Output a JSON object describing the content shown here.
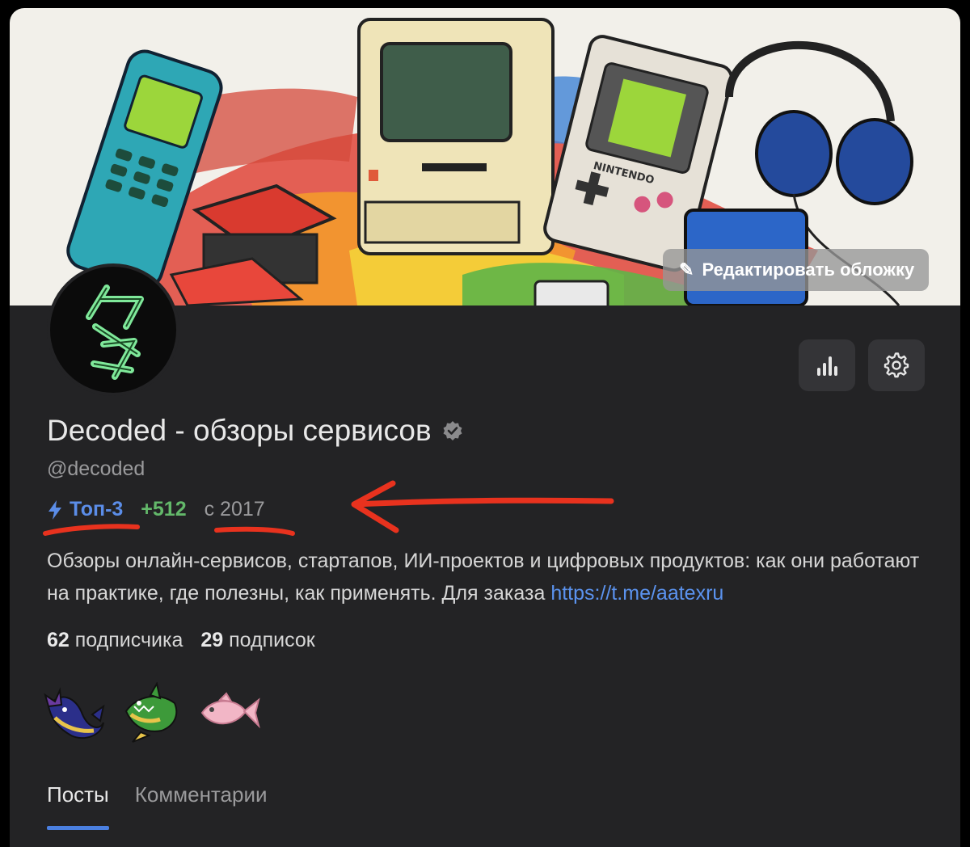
{
  "cover": {
    "edit_label": "Редактировать обложку",
    "edit_icon": "pencil-icon",
    "device_text": "NINTENDO"
  },
  "toolbar": {
    "stats_icon": "bar-chart-icon",
    "settings_icon": "gear-icon"
  },
  "profile": {
    "name": "Decoded - обзоры сервисов",
    "handle": "@decoded",
    "rank": "Топ-3",
    "karma": "+512",
    "since": "с 2017",
    "description": "Обзоры онлайн-сервисов, стартапов, ИИ-проектов и цифровых продуктов: как они работают на практике, где полезны, как применять. Для заказа ",
    "link": "https://t.me/aatexru",
    "subscribers_count": "62",
    "subscribers_label": "подписчика",
    "subscriptions_count": "29",
    "subscriptions_label": "подписок"
  },
  "badges": [
    "whale-badge-icon",
    "shark-badge-icon",
    "fish-badge-icon"
  ],
  "tabs": [
    {
      "label": "Посты",
      "active": true
    },
    {
      "label": "Комментарии",
      "active": false
    }
  ],
  "colors": {
    "accent": "#4a7fe0",
    "rank": "#5b8de8",
    "karma": "#63b86a",
    "annotation": "#e8321e",
    "card": "#232325"
  }
}
